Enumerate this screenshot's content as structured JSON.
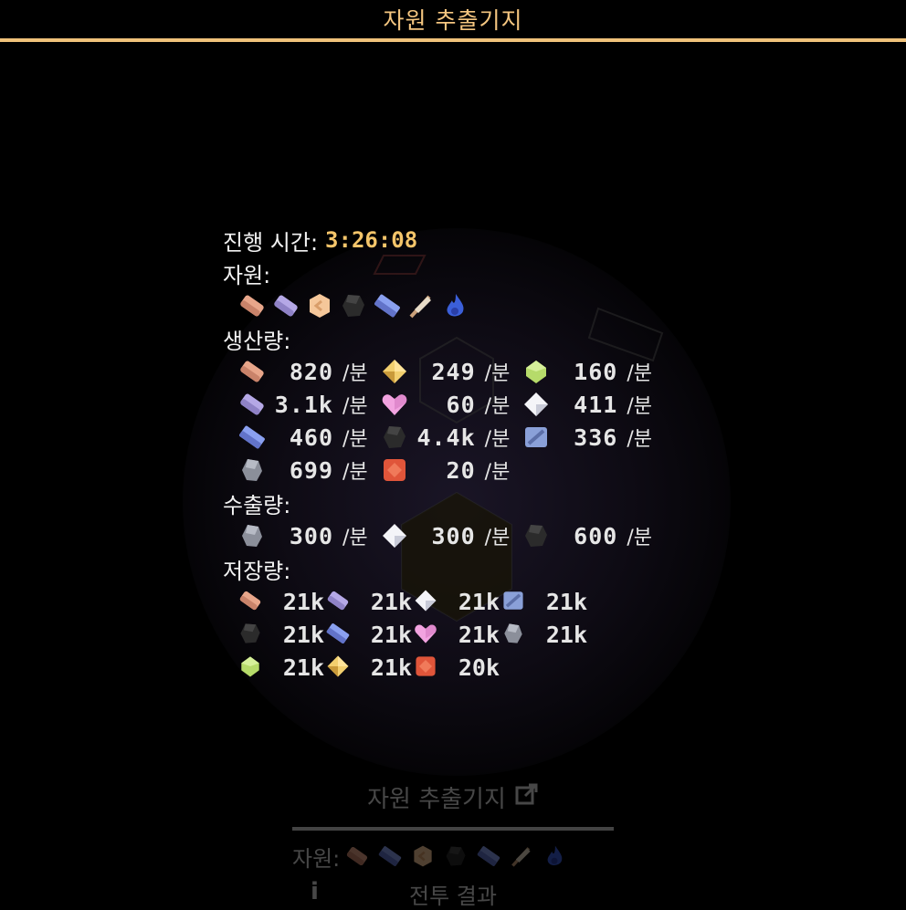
{
  "header": {
    "title": "자원 추출기지"
  },
  "panel": {
    "elapsed_label": "진행 시간:",
    "elapsed_value": "3:26:08",
    "resources_label": "자원:",
    "resources": [
      "copper-ingot-icon",
      "lavender-ingot-icon",
      "peach-orb-icon",
      "dark-ore-icon",
      "blue-crystal-icon",
      "feather-icon",
      "blue-flame-icon"
    ],
    "production_label": "생산량:",
    "production_rows": [
      [
        {
          "icon": "copper-ingot-icon",
          "value": "820",
          "unit": "/분"
        },
        {
          "icon": "yellow-gem-icon",
          "value": "249",
          "unit": "/분"
        },
        {
          "icon": "green-gem-icon",
          "value": "160",
          "unit": "/분"
        }
      ],
      [
        {
          "icon": "lavender-ingot-icon",
          "value": "3.1k",
          "unit": "/분"
        },
        {
          "icon": "pink-heart-icon",
          "value": "60",
          "unit": "/분"
        },
        {
          "icon": "white-crystal-icon",
          "value": "411",
          "unit": "/분"
        }
      ],
      [
        {
          "icon": "blue-crystal-icon",
          "value": "460",
          "unit": "/분"
        },
        {
          "icon": "dark-ore-icon",
          "value": "4.4k",
          "unit": "/분"
        },
        {
          "icon": "steel-block-icon",
          "value": "336",
          "unit": "/분"
        }
      ],
      [
        {
          "icon": "grey-ore-icon",
          "value": "699",
          "unit": "/분"
        },
        {
          "icon": "red-gem-icon",
          "value": "20",
          "unit": "/분"
        }
      ]
    ],
    "export_label": "수출량:",
    "export_row": [
      {
        "icon": "grey-ore-icon",
        "value": "300",
        "unit": "/분"
      },
      {
        "icon": "white-crystal-icon",
        "value": "300",
        "unit": "/분"
      },
      {
        "icon": "dark-ore-icon",
        "value": "600",
        "unit": "/분"
      }
    ],
    "storage_label": "저장량:",
    "storage_rows": [
      [
        {
          "icon": "copper-ingot-icon",
          "value": "21k"
        },
        {
          "icon": "lavender-ingot-icon",
          "value": "21k"
        },
        {
          "icon": "white-crystal-icon",
          "value": "21k"
        },
        {
          "icon": "steel-block-icon",
          "value": "21k"
        }
      ],
      [
        {
          "icon": "dark-ore-icon",
          "value": "21k"
        },
        {
          "icon": "blue-crystal-icon",
          "value": "21k"
        },
        {
          "icon": "pink-heart-icon",
          "value": "21k"
        },
        {
          "icon": "grey-ore-icon",
          "value": "21k"
        }
      ],
      [
        {
          "icon": "green-gem-icon",
          "value": "21k"
        },
        {
          "icon": "yellow-gem-icon",
          "value": "21k"
        },
        {
          "icon": "red-gem-icon",
          "value": "20k"
        }
      ]
    ]
  },
  "bottom_card": {
    "title": "자원 추출기지",
    "title_icon": "external-link-icon",
    "resources_label": "자원:",
    "resources": [
      "copper-ingot-icon",
      "blue-crystal-icon",
      "peach-orb-icon",
      "dark-ore-icon",
      "blue-crystal-icon",
      "feather-icon",
      "blue-flame-icon"
    ],
    "info_icon": "info-icon",
    "battle_result_label": "전투 결과"
  },
  "colors": {
    "title_gold": "#f5c680",
    "divider_gold": "#f0c27a",
    "time_gold": "#f4c56a",
    "text_white": "#f2f2f2"
  }
}
